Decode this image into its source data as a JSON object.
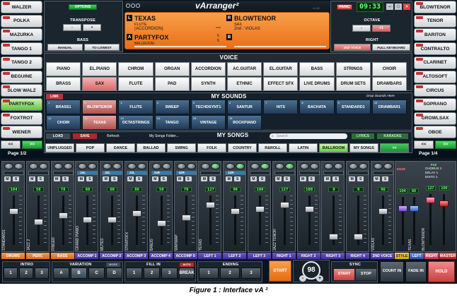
{
  "app": {
    "logo": "vArranger²",
    "version": "v1.00"
  },
  "left_styles": {
    "items": [
      {
        "label": "WALZER",
        "selected": false
      },
      {
        "label": "POLKA",
        "selected": false
      },
      {
        "label": "MAZURKA",
        "selected": false
      },
      {
        "label": "TANGO 1",
        "selected": false
      },
      {
        "label": "TANGO 2",
        "selected": false
      },
      {
        "label": "BEGUINE",
        "selected": false
      },
      {
        "label": "SLOW WALZ",
        "selected": false
      },
      {
        "label": "PARTYFOX",
        "selected": true
      },
      {
        "label": "FOXTROT",
        "selected": false
      },
      {
        "label": "WIENER",
        "selected": false
      }
    ],
    "prev": "<<",
    "next": ">>",
    "page": "Page 1/2"
  },
  "right_styles": {
    "items": [
      {
        "label": "BLOWTENOR"
      },
      {
        "label": "TENOR"
      },
      {
        "label": "BARITON"
      },
      {
        "label": "CONTRALTO"
      },
      {
        "label": "CLARINET"
      },
      {
        "label": "ALTOSOFT"
      },
      {
        "label": "CIRCUS"
      },
      {
        "label": "SOPRANO"
      },
      {
        "label": "GROWLSAX"
      },
      {
        "label": "OBOE"
      }
    ],
    "prev": "<<",
    "next": ">>",
    "page": "Page 1/4"
  },
  "top": {
    "options": "OPTIONS",
    "panic": "PANIC",
    "clock": "09:33",
    "transpose": {
      "title": "TRANSPOSE",
      "minus": "-",
      "plus": "+"
    },
    "bass": {
      "title": "BASS",
      "manual": "MANUAL",
      "to_lowest": "TO LOWEST"
    },
    "octave": {
      "title": "OCTAVE",
      "minus": "-",
      "plus": "+1"
    },
    "right": {
      "title": "RIGHT",
      "second_voice": "2ND VOICE",
      "full_keyboard": "FULL KEYBOARD"
    }
  },
  "display": {
    "l_tag": "L",
    "l_name": "TEXAS",
    "l_sub1": "FLUTE",
    "l_sub2": "(ACCORDION)",
    "r_tag": "R",
    "r_name": "BLOWTENOR",
    "r_sub1": "SAX",
    "r_sub2": "2nd : VIOLAS",
    "a_tag": "A",
    "a_name": "PARTYFOX",
    "a_sub": "BALLROOM",
    "b_tag": "B",
    "dashes": "---",
    "num_top": "5",
    "num_bot": "6"
  },
  "voice": {
    "title": "VOICE",
    "row1": [
      "PIANO",
      "EL.PIANO",
      "CHROM",
      "ORGAN",
      "ACCORDION",
      "AC.GUITAR",
      "EL.GUITAR",
      "BASS",
      "STRINGS",
      "CHOIR"
    ],
    "row2": [
      "BRASS",
      "SAX",
      "FLUTE",
      "PAD",
      "SYNTH",
      "ETHNIC",
      "EFFECT SFX",
      "LIVE DRUMS",
      "DRUM SETS",
      "DRAWBARS"
    ],
    "selected": "SAX"
  },
  "sounds": {
    "link": "LINK",
    "title": "MY SOUNDS",
    "hint": "Drop Sounds Here",
    "row1": [
      "BRASS1",
      "BLOWTENOR",
      "FLUTE",
      "SWEEP",
      "TECHDSYNT1",
      "SANTUR",
      "HITS",
      "BACHATA",
      "STANDARD1",
      "DRAWBAR1"
    ],
    "row2": [
      "CHOIR",
      "TEXAS",
      "OCTASTRINGS",
      "TANGO",
      "VINTAGE",
      "ROCKPIANO"
    ],
    "nums1": [
      "1",
      "2",
      "3",
      "4",
      "5",
      "6",
      "7",
      "8",
      "9",
      "10"
    ],
    "nums2": [
      "11",
      "12",
      "13",
      "14",
      "15",
      "16"
    ]
  },
  "songs": {
    "load": "LOAD",
    "save": "SAVE",
    "refresh": "Refresh",
    "folder": "My Songs Folder...",
    "title": "MY SONGS",
    "search": "Search",
    "lyrics": "LYRICS",
    "karaoke": "KARAOKE",
    "genres": [
      "UNPLUGGED",
      "POP",
      "DANCE",
      "BALLAD",
      "SWING",
      "FOLK",
      "COUNTRY",
      "R&ROLL",
      "LATIN",
      "BALLROOM",
      "MY SONGS",
      ">>"
    ],
    "selected": "BALLROOM"
  },
  "mixer": {
    "channels": [
      {
        "name": "STANDARD1",
        "vol": "104",
        "label": "DRUMS",
        "lamp": "",
        "handle": 0.3
      },
      {
        "name": "JAZZ 2",
        "vol": "58",
        "label": "PERC",
        "lamp": "",
        "handle": 0.55
      },
      {
        "name": "FINGER",
        "vol": "78",
        "label": "BASS",
        "lamp": "",
        "handle": 0.4
      },
      {
        "name": "GRAND PIANO",
        "vol": "60",
        "label": "ACCOMP 1",
        "lamp": "24L",
        "handle": 0.5
      },
      {
        "name": "MUTES",
        "vol": "60",
        "label": "ACCOMP 2",
        "lamp": "32L",
        "handle": 0.5
      },
      {
        "name": "STRATOFX",
        "vol": "86",
        "label": "ACCOMP 3",
        "lamp": "22L",
        "handle": 0.35
      },
      {
        "name": "BANJO",
        "vol": "50",
        "label": "ACCOMP 4",
        "lamp": "24R",
        "handle": 0.58
      },
      {
        "name": "WAHWAP",
        "vol": "70",
        "label": "ACCOMP 5",
        "lamp": "32R",
        "handle": 0.45
      },
      {
        "name": "TEXAS",
        "vol": "127",
        "label": "LEFT 1",
        "lamp": "",
        "handle": 0.15
      },
      {
        "name": "",
        "vol": "90",
        "label": "LEFT 2",
        "lamp": "22R",
        "handle": 0.3
      },
      {
        "name": "",
        "vol": "100",
        "label": "LEFT 3",
        "lamp": "",
        "handle": 0.25
      },
      {
        "name": "JAZZ TENOR",
        "vol": "127",
        "label": "RIGHT 1",
        "lamp": "",
        "handle": 0.15
      },
      {
        "name": "",
        "vol": "100",
        "label": "RIGHT 2",
        "lamp": "",
        "handle": 0.25
      },
      {
        "name": "",
        "vol": "0",
        "label": "RIGHT 3",
        "lamp": "",
        "handle": 0.9
      },
      {
        "name": "",
        "vol": "0",
        "label": "RIGHT 4",
        "lamp": "",
        "handle": 0.9
      },
      {
        "name": "VIOLAS",
        "vol": "96",
        "label": "2ND VOICE",
        "lamp": "",
        "handle": 0.3
      }
    ],
    "m": "M",
    "s": "S",
    "style_col": {
      "name": "TEXAS",
      "vol": "104",
      "label": "STYLE",
      "title": "ENSE"
    },
    "left_col": {
      "name": "",
      "vol": "60",
      "label": "LEFT"
    },
    "right_col": {
      "name": "BLOWTENOR",
      "vol": "127",
      "label": "RIGHT"
    },
    "master": {
      "vol": "100",
      "label": "MASTER"
    },
    "fx": {
      "title": "FX2",
      "line1": "CHORUS 1",
      "line2": "DELAY 1",
      "line3": "DISTO 1"
    }
  },
  "bottom": {
    "intro": {
      "title": "INTRO",
      "buttons": [
        "1",
        "2",
        "3"
      ]
    },
    "variation": {
      "title": "VARIATION",
      "mode": "MODE",
      "buttons": [
        "A",
        "B",
        "C",
        "D"
      ]
    },
    "fillin": {
      "title": "FILL IN",
      "auto": "AUTO",
      "buttons": [
        "1",
        "2",
        "3"
      ],
      "break": "BREAK"
    },
    "ending": {
      "title": "ENDING",
      "buttons": [
        "1",
        "2",
        "3"
      ]
    },
    "start": "START",
    "tempo": "98",
    "tempo_minus": "-",
    "tempo_plus": "+",
    "sync": {
      "title": "SYNC",
      "start": "START",
      "stop": "STOP"
    },
    "count_in": "COUNT IN",
    "fade_in": "FADE IN",
    "hold": "HOLD"
  },
  "caption": "Figure 1 : Interface vA ²"
}
